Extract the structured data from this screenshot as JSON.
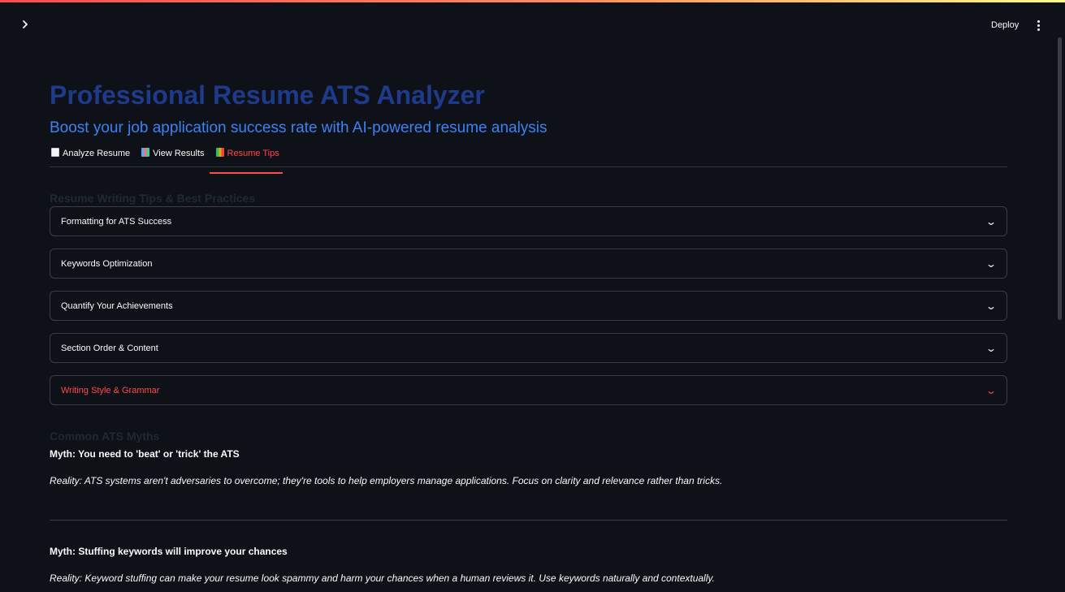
{
  "header": {
    "sidebar_toggle_icon": "chevron-right-icon",
    "deploy_label": "Deploy",
    "menu_icon": "kebab-menu-icon"
  },
  "page": {
    "title": "Professional Resume ATS Analyzer",
    "subtitle": "Boost your job application success rate with AI-powered resume analysis",
    "title_color": "#1e3a8a",
    "subtitle_color": "#3b82f6",
    "accent_color": "#ff4b4b"
  },
  "tabs": [
    {
      "icon": "document-icon",
      "label": "Analyze Resume",
      "active": false
    },
    {
      "icon": "bar-chart-icon",
      "label": "View Results",
      "active": false
    },
    {
      "icon": "books-icon",
      "label": "Resume Tips",
      "active": true
    }
  ],
  "tips": {
    "heading": "Resume Writing Tips & Best Practices",
    "expanders": [
      {
        "label": "Formatting for ATS Success"
      },
      {
        "label": "Keywords Optimization"
      },
      {
        "label": "Quantify Your Achievements"
      },
      {
        "label": "Section Order & Content"
      },
      {
        "label": "Writing Style & Grammar"
      }
    ]
  },
  "myths": {
    "heading": "Common ATS Myths",
    "items": [
      {
        "myth": "Myth: You need to 'beat' or 'trick' the ATS",
        "reality": "Reality: ATS systems aren't adversaries to overcome; they're tools to help employers manage applications. Focus on clarity and relevance rather than tricks."
      },
      {
        "myth": "Myth: Stuffing keywords will improve your chances",
        "reality": "Reality: Keyword stuffing can make your resume look spammy and harm your chances when a human reviews it. Use keywords naturally and contextually."
      }
    ]
  }
}
